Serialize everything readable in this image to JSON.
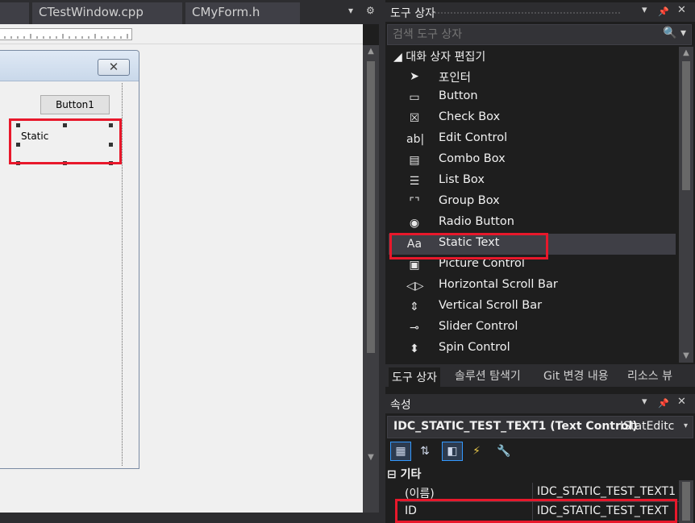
{
  "editor": {
    "tabs": [
      {
        "label": ""
      },
      {
        "label": "CTestWindow.cpp"
      },
      {
        "label": "CMyForm.h"
      }
    ],
    "tab_controls": {
      "dropdown": "▾",
      "settings": "⚙"
    },
    "dialog": {
      "close_glyph": "✕",
      "button_label": "Button1",
      "static_label": "Static"
    }
  },
  "toolbox": {
    "title": "도구 상자",
    "controls": {
      "dropdown": "▾",
      "pin": "📌",
      "close": "✕"
    },
    "search_placeholder": "검색 도구 상자",
    "search_icon": "🔍",
    "group_header": "◢ 대화 상자 편집기",
    "selected_index": 8,
    "items": [
      {
        "label": "포인터",
        "icon": "pointer-icon",
        "glyph": "➤"
      },
      {
        "label": "Button",
        "icon": "button-icon",
        "glyph": "▭"
      },
      {
        "label": "Check Box",
        "icon": "checkbox-icon",
        "glyph": "☒"
      },
      {
        "label": "Edit Control",
        "icon": "edit-control-icon",
        "glyph": "ab|"
      },
      {
        "label": "Combo Box",
        "icon": "combo-box-icon",
        "glyph": "▤"
      },
      {
        "label": "List Box",
        "icon": "list-box-icon",
        "glyph": "☰"
      },
      {
        "label": "Group Box",
        "icon": "group-box-icon",
        "glyph": "⌜⌝"
      },
      {
        "label": "Radio Button",
        "icon": "radio-button-icon",
        "glyph": "◉"
      },
      {
        "label": "Static Text",
        "icon": "static-text-icon",
        "glyph": "Aa"
      },
      {
        "label": "Picture Control",
        "icon": "picture-control-icon",
        "glyph": "▣"
      },
      {
        "label": "Horizontal Scroll Bar",
        "icon": "horizontal-scrollbar-icon",
        "glyph": "◁▷"
      },
      {
        "label": "Vertical Scroll Bar",
        "icon": "vertical-scrollbar-icon",
        "glyph": "⇕"
      },
      {
        "label": "Slider Control",
        "icon": "slider-control-icon",
        "glyph": "⊸"
      },
      {
        "label": "Spin Control",
        "icon": "spin-control-icon",
        "glyph": "⬍"
      }
    ]
  },
  "bottom_tabs": [
    {
      "label": "도구 상자",
      "active": true
    },
    {
      "label": "솔루션 탐색기",
      "active": false
    },
    {
      "label": "Git 변경 내용",
      "active": false
    },
    {
      "label": "리소스 뷰",
      "active": false
    }
  ],
  "properties": {
    "title": "속성",
    "controls": {
      "dropdown": "▾",
      "pin": "📌",
      "close": "✕"
    },
    "object_name": "IDC_STATIC_TEST_TEXT1 (Text Control)",
    "object_type": "IStatEditc",
    "object_dropdown": "▾",
    "toolbar": [
      {
        "icon": "categorized-icon",
        "glyph": "▦",
        "on": true
      },
      {
        "icon": "alphabetical-icon",
        "glyph": "⇅",
        "on": false
      },
      {
        "icon": "properties-page-icon",
        "glyph": "◧",
        "on": true
      },
      {
        "icon": "events-icon",
        "glyph": "⚡",
        "on": false
      },
      {
        "icon": "property-pages-icon",
        "glyph": "🔧",
        "on": false
      }
    ],
    "category_label": "⊟ 기타",
    "rows": [
      {
        "key": "(이름)",
        "value": "IDC_STATIC_TEST_TEXT1 (",
        "highlight": false
      },
      {
        "key": "ID",
        "value": "IDC_STATIC_TEST_TEXT",
        "highlight": true
      }
    ]
  },
  "colors": {
    "highlight_red": "#e8182b",
    "panel_bg": "#1e1e1e",
    "title_bg": "#2d2d30",
    "designer_bg": "#f0f0f0",
    "selection_blue": "#3399ff"
  }
}
